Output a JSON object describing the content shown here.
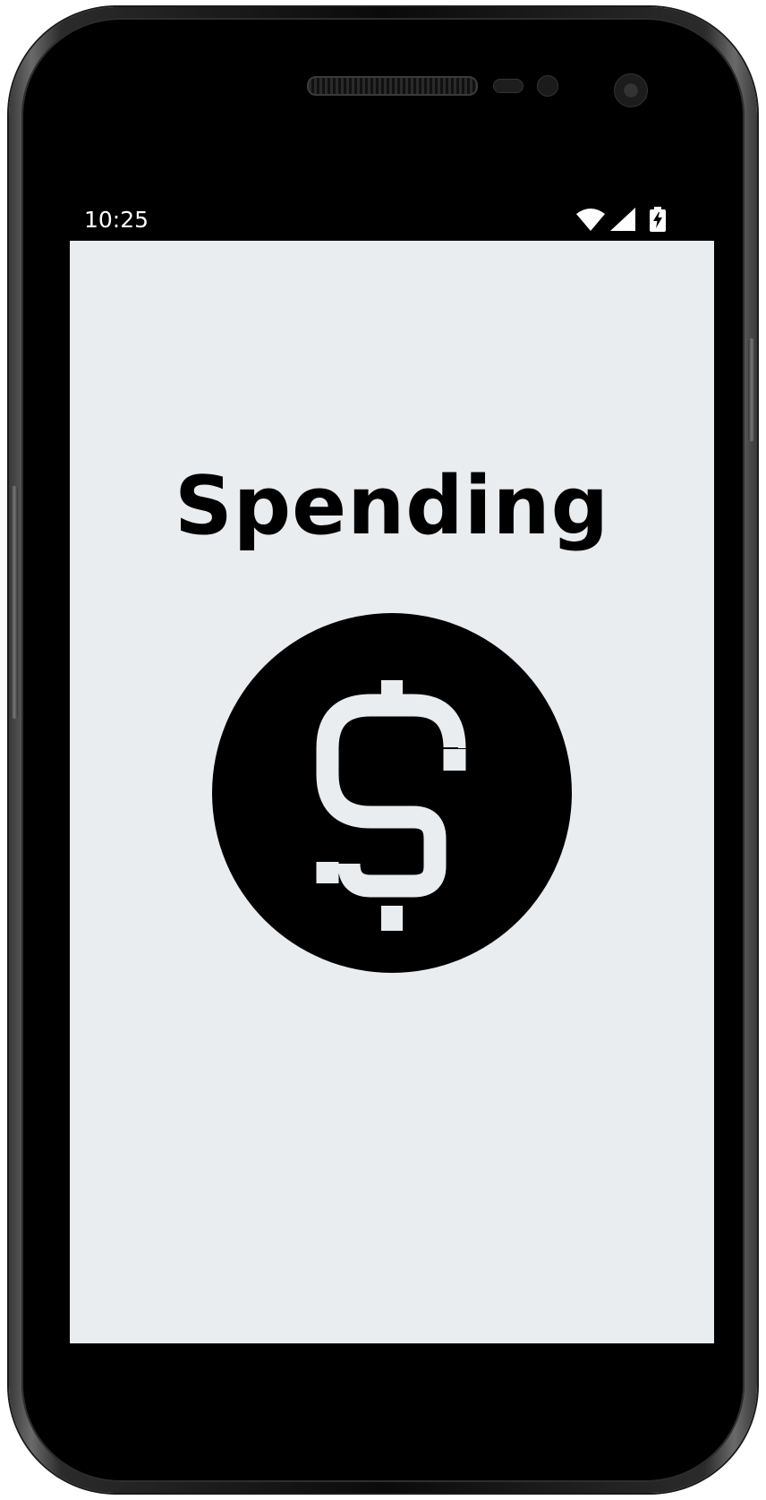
{
  "status_bar": {
    "time": "10:25",
    "icons": [
      "wifi-icon",
      "cellular-signal-icon",
      "battery-charging-icon"
    ]
  },
  "main": {
    "title": "Spending",
    "icon": "dollar-circle-icon"
  },
  "colors": {
    "screen_background": "#e9edf0",
    "status_bar_background": "#000000",
    "title_color": "#000000",
    "icon_circle": "#000000",
    "icon_symbol": "#e9edf0"
  }
}
